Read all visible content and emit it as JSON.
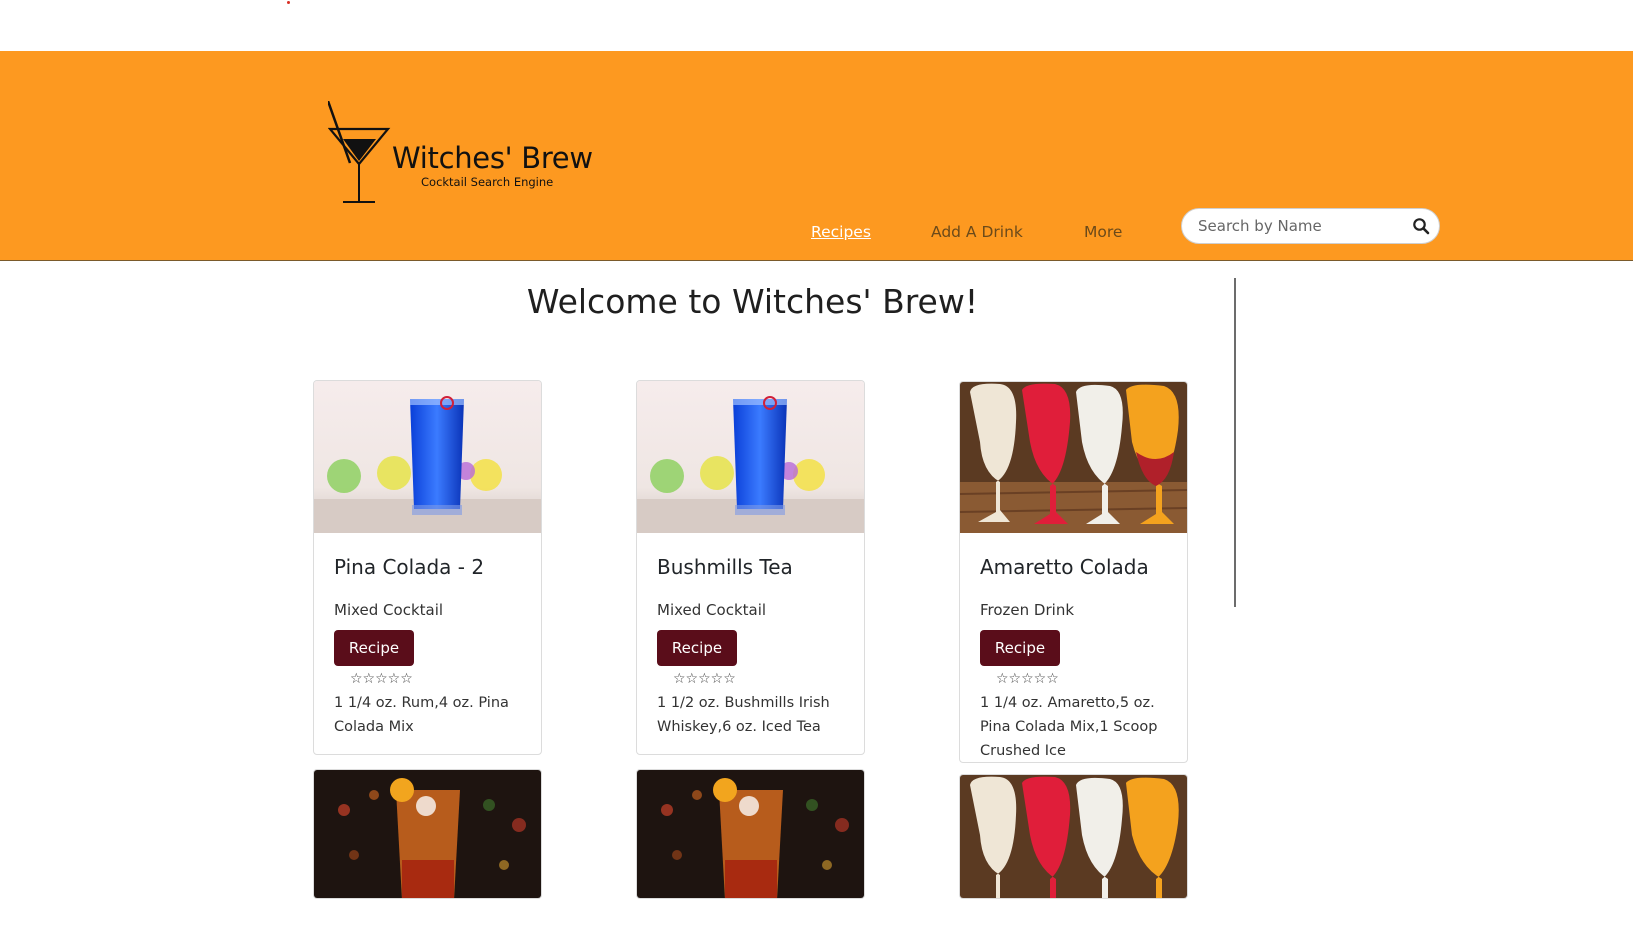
{
  "header": {
    "logo_title": "Witches' Brew",
    "logo_subtitle": "Cocktail Search Engine",
    "nav": [
      {
        "label": "Recipes",
        "active": true
      },
      {
        "label": "Add A Drink",
        "active": false
      },
      {
        "label": "More",
        "active": false
      }
    ],
    "search": {
      "placeholder": "Search by Name",
      "value": ""
    }
  },
  "main": {
    "welcome": "Welcome to Witches' Brew!",
    "cards": [
      {
        "name": "Pina Colada - 2",
        "type": "Mixed Cocktail",
        "button": "Recipe",
        "rating": "☆☆☆☆☆",
        "ingredients": "1 1/4 oz. Rum,4 oz. Pina Colada Mix",
        "image": "blue-cocktail"
      },
      {
        "name": "Bushmills Tea",
        "type": "Mixed Cocktail",
        "button": "Recipe",
        "rating": "☆☆☆☆☆",
        "ingredients": "1 1/2 oz. Bushmills Irish Whiskey,6 oz. Iced Tea",
        "image": "blue-cocktail"
      },
      {
        "name": "Amaretto Colada",
        "type": "Frozen Drink",
        "button": "Recipe",
        "rating": "☆☆☆☆☆",
        "ingredients": "1 1/4 oz. Amaretto,5 oz. Pina Colada Mix,1 Scoop Crushed Ice",
        "image": "frozen-drinks"
      }
    ],
    "bottom_cards": [
      {
        "image": "orange-cocktail"
      },
      {
        "image": "orange-cocktail"
      },
      {
        "image": "frozen-drinks"
      }
    ]
  },
  "colors": {
    "header_bg": "#fd9920",
    "recipe_button": "#5a0d1a",
    "active_nav": "#ffffff",
    "nav_link": "#6b4a1a"
  },
  "icons": {
    "logo": "martini-glass-icon",
    "search": "search-icon",
    "rating": "star-icon"
  }
}
